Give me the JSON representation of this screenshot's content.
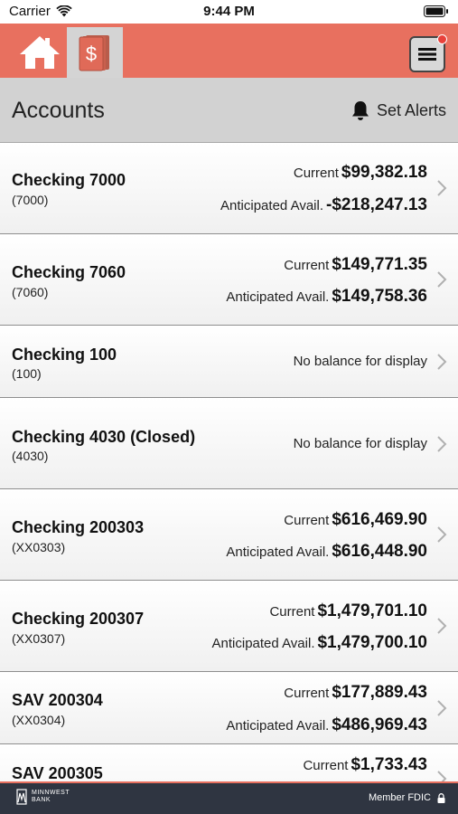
{
  "status_bar": {
    "carrier": "Carrier",
    "time": "9:44 PM"
  },
  "nav": {
    "home_icon": "home-icon",
    "accounts_icon": "dollar-book-icon",
    "menu_icon": "hamburger-menu-icon",
    "accent_color": "#e8705f"
  },
  "header": {
    "title": "Accounts",
    "alerts_label": "Set Alerts"
  },
  "accounts": [
    {
      "name": "Checking 7000",
      "number": "(7000)",
      "current_label": "Current",
      "current": "$99,382.18",
      "anticipated_label": "Anticipated Avail.",
      "anticipated": "-$218,247.13"
    },
    {
      "name": "Checking 7060",
      "number": "(7060)",
      "current_label": "Current",
      "current": "$149,771.35",
      "anticipated_label": "Anticipated Avail.",
      "anticipated": "$149,758.36"
    },
    {
      "name": "Checking 100",
      "number": "(100)",
      "no_balance": "No balance for display"
    },
    {
      "name": "Checking 4030 (Closed)",
      "number": "(4030)",
      "no_balance": "No balance for display"
    },
    {
      "name": "Checking 200303",
      "number": "(XX0303)",
      "current_label": "Current",
      "current": "$616,469.90",
      "anticipated_label": "Anticipated Avail.",
      "anticipated": "$616,448.90"
    },
    {
      "name": "Checking 200307",
      "number": "(XX0307)",
      "current_label": "Current",
      "current": "$1,479,701.10",
      "anticipated_label": "Anticipated Avail.",
      "anticipated": "$1,479,700.10"
    },
    {
      "name": "SAV 200304",
      "number": "(XX0304)",
      "current_label": "Current",
      "current": "$177,889.43",
      "anticipated_label": "Anticipated Avail.",
      "anticipated": "$486,969.43"
    },
    {
      "name": "SAV 200305",
      "current_label": "Current",
      "current": "$1,733.43"
    }
  ],
  "footer": {
    "logo_line1": "MINNWEST",
    "logo_line2": "BANK",
    "member_text": "Member FDIC",
    "lock_icon": "lock-icon"
  }
}
